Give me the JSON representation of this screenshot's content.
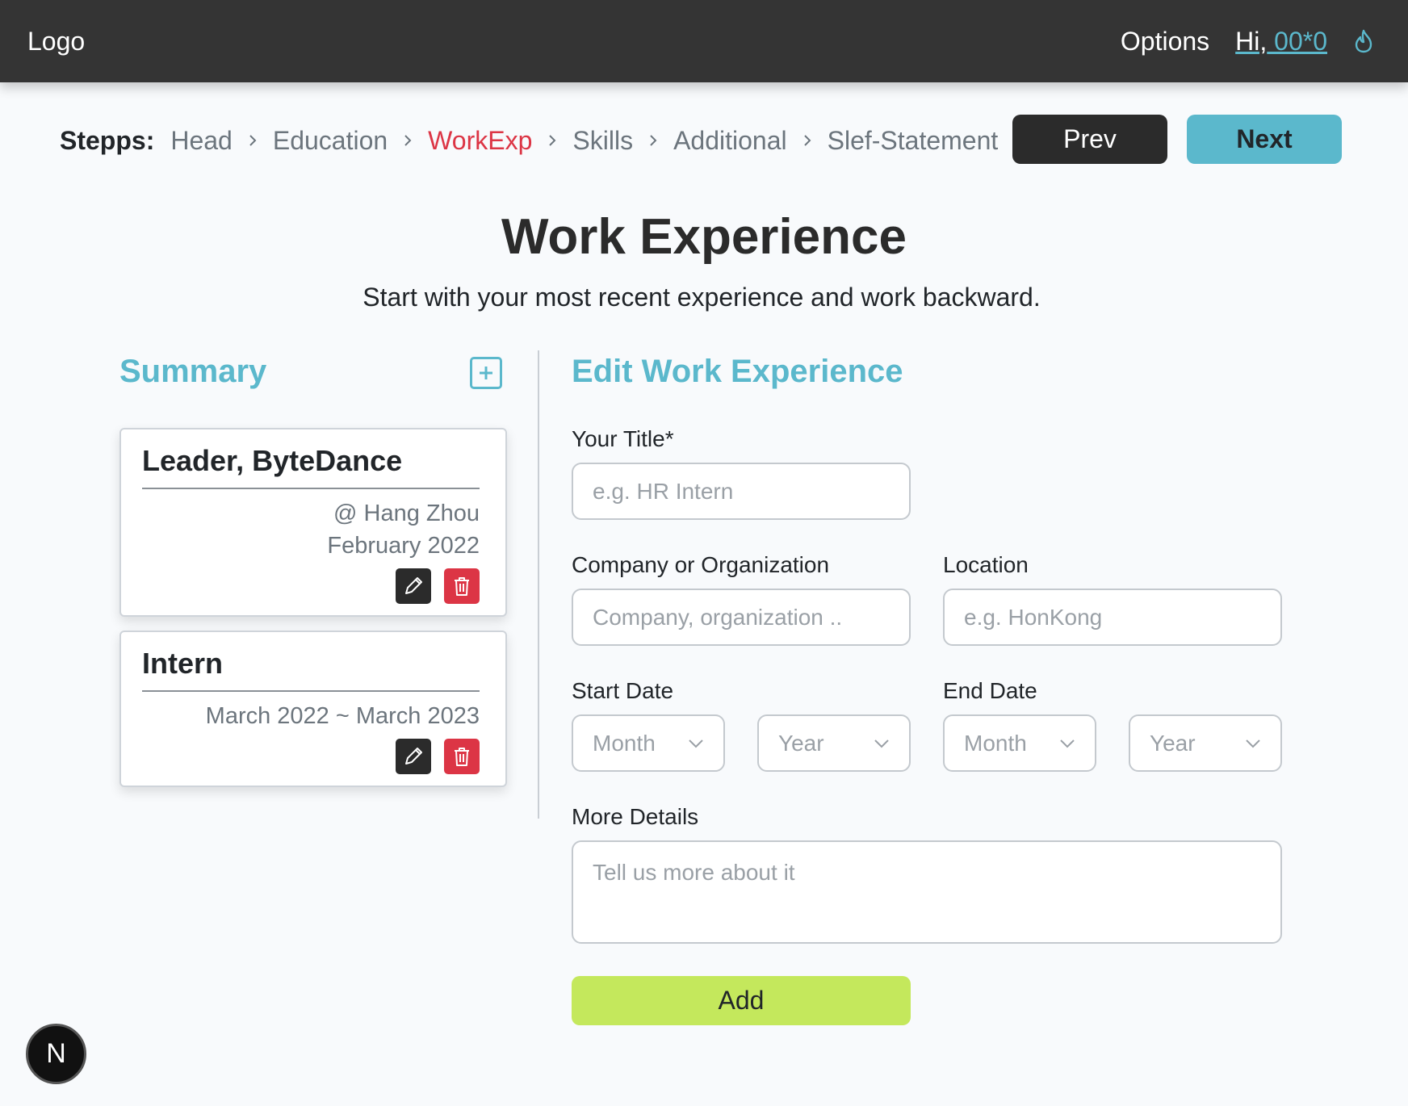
{
  "navbar": {
    "logo": "Logo",
    "options": "Options",
    "greeting": "Hi,",
    "username": " 00*0",
    "icon": "flame-icon"
  },
  "steps": {
    "label": "Stepps:",
    "items": [
      "Head",
      "Education",
      "WorkExp",
      "Skills",
      "Additional",
      "Slef-Statement"
    ],
    "active": "WorkExp"
  },
  "buttons": {
    "prev": "Prev",
    "next": "Next",
    "add": "Add"
  },
  "page": {
    "title": "Work Experience",
    "subtitle": "Start with your most recent experience and work backward."
  },
  "summary": {
    "title": "Summary",
    "cards": [
      {
        "title": "Leader, ByteDance",
        "location": "@ Hang Zhou",
        "date": "February 2022"
      },
      {
        "title": "Intern",
        "date": "March 2022 ~ March 2023"
      }
    ]
  },
  "form": {
    "title": "Edit Work Experience",
    "title_label": "Your Title*",
    "title_placeholder": "e.g. HR Intern",
    "company_label": "Company or Organization",
    "company_placeholder": "Company, organization ..",
    "location_label": "Location",
    "location_placeholder": "e.g. HonKong",
    "start_label": "Start Date",
    "end_label": "End Date",
    "month": "Month",
    "year": "Year",
    "details_label": "More Details",
    "details_placeholder": "Tell us more about it"
  },
  "badge": "N",
  "colors": {
    "accent": "#5bb8cc",
    "active_step": "#dc3545",
    "add_button": "#c4e85c",
    "navbar": "#343434"
  }
}
